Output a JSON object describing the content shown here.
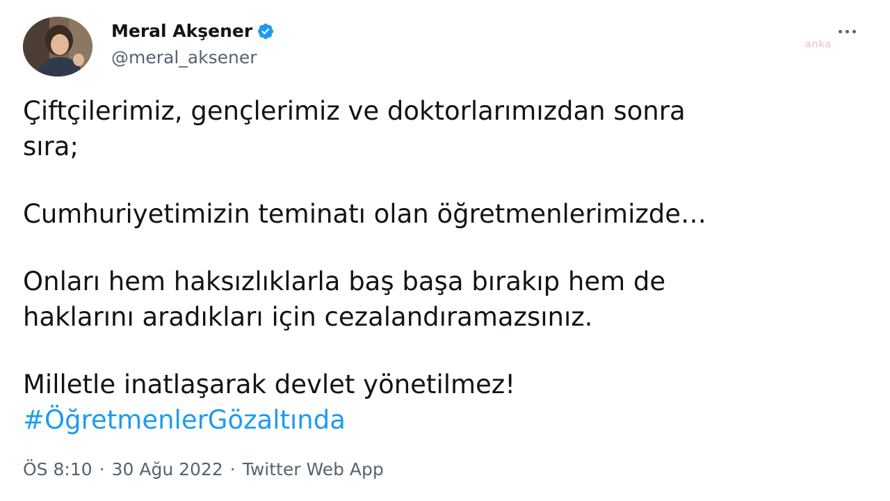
{
  "author": {
    "display_name": "Meral Akşener",
    "handle": "@meral_aksener",
    "verified": true
  },
  "watermark": "anka",
  "tweet": {
    "paragraphs": [
      "Çiftçilerimiz, gençlerimiz ve doktorlarımızdan sonra",
      "sıra;",
      "Cumhuriyetimizin teminatı olan öğretmenlerimizde…",
      "Onları hem haksızlıklarla baş başa bırakıp hem de",
      "haklarını aradıkları için cezalandıramazsınız.",
      "Milletle inatlaşarak devlet yönetilmez!"
    ],
    "hashtag": "#ÖğretmenlerGözaltında"
  },
  "meta": {
    "time": "ÖS 8:10",
    "separator": "·",
    "date": "30 Ağu 2022",
    "source": "Twitter Web App"
  },
  "icons": {
    "verified": "verified-badge-icon",
    "more": "more-options-icon"
  },
  "colors": {
    "text": "#0f1419",
    "secondary": "#536471",
    "accent": "#1d9bf0"
  }
}
